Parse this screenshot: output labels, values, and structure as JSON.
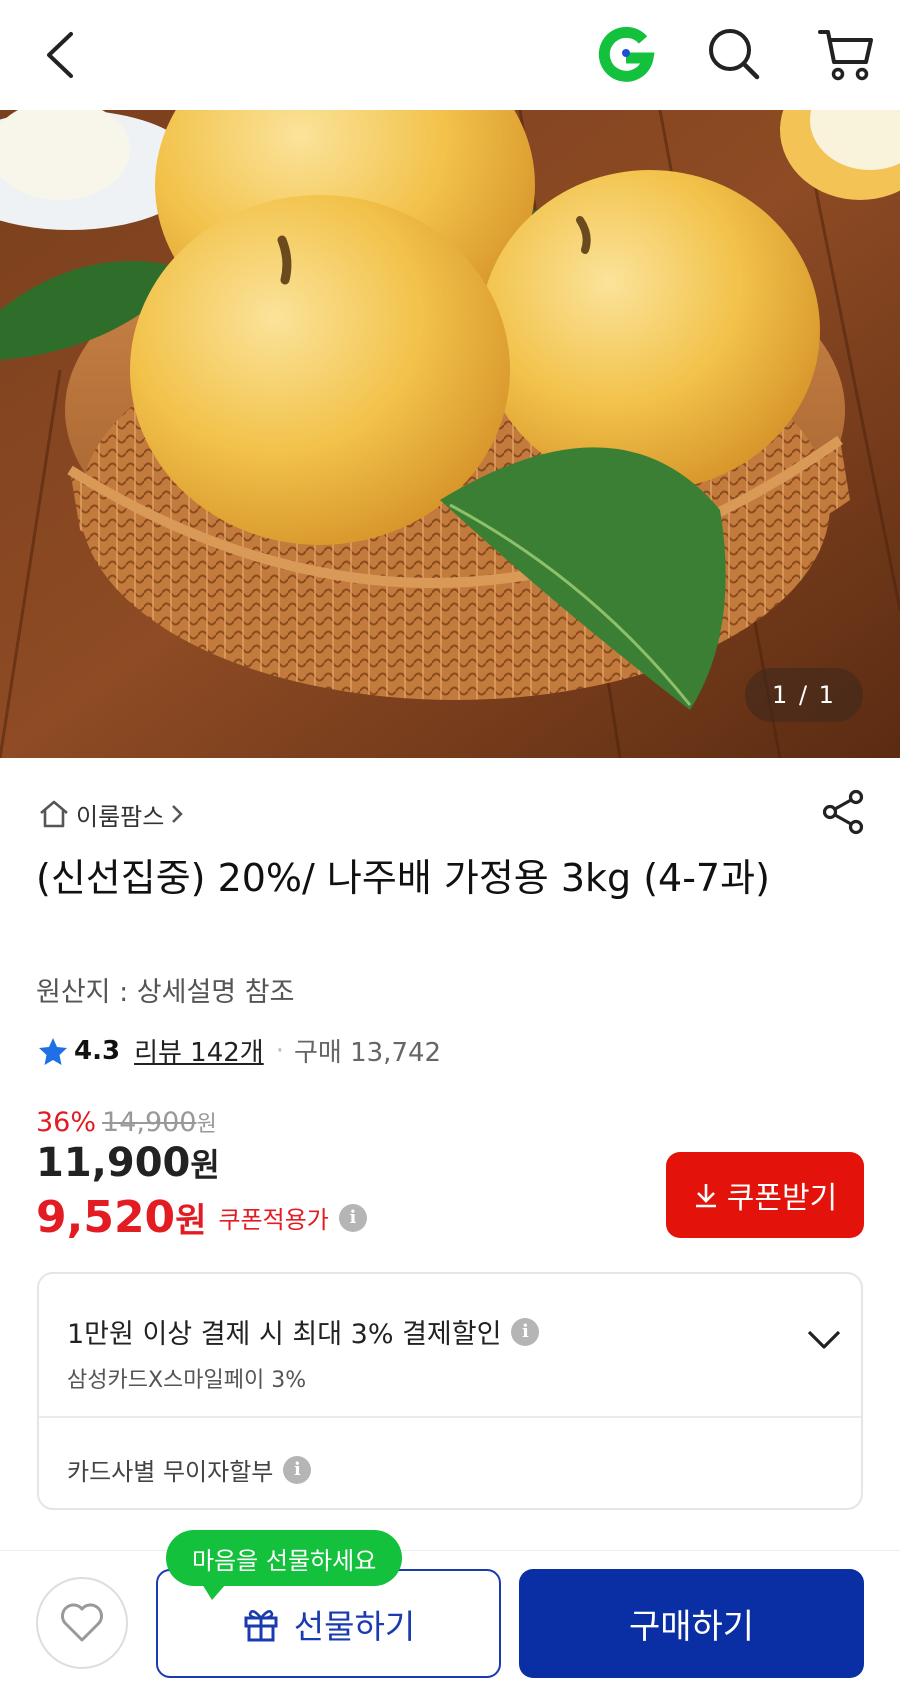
{
  "header": {
    "back_icon": "chevron-left-icon",
    "logo_letter": "G",
    "logo_color": "#14c13d",
    "search_icon": "search-icon",
    "cart_icon": "cart-icon"
  },
  "gallery": {
    "counter": "1 / 1",
    "image_subject": "pears-in-basket"
  },
  "product": {
    "seller": "이룸팜스",
    "title": "(신선집중) 20%/ 나주배 가정용 3kg (4-7과)",
    "origin": "원산지 : 상세설명 참조",
    "rating": "4.3",
    "review_text": "리뷰 142개",
    "purchase_text": "구매 13,742",
    "discount_rate": "36%",
    "original_price": "14,900",
    "original_price_unit": "원",
    "price": "11,900",
    "price_unit": "원",
    "coupon_price": "9,520",
    "coupon_price_unit": "원",
    "coupon_price_label": "쿠폰적용가",
    "coupon_button_label": "쿠폰받기"
  },
  "benefits": {
    "payment_discount": "1만원 이상 결제 시 최대 3% 결제할인",
    "payment_card": "삼성카드X스마일페이 3%",
    "installment": "카드사별 무이자할부"
  },
  "bottom_bar": {
    "tooltip": "마음을 선물하세요",
    "gift_label": "선물하기",
    "buy_label": "구매하기"
  },
  "colors": {
    "accent_red": "#e31b23",
    "primary_blue": "#0a2ea4",
    "gift_green": "#14c13d"
  }
}
